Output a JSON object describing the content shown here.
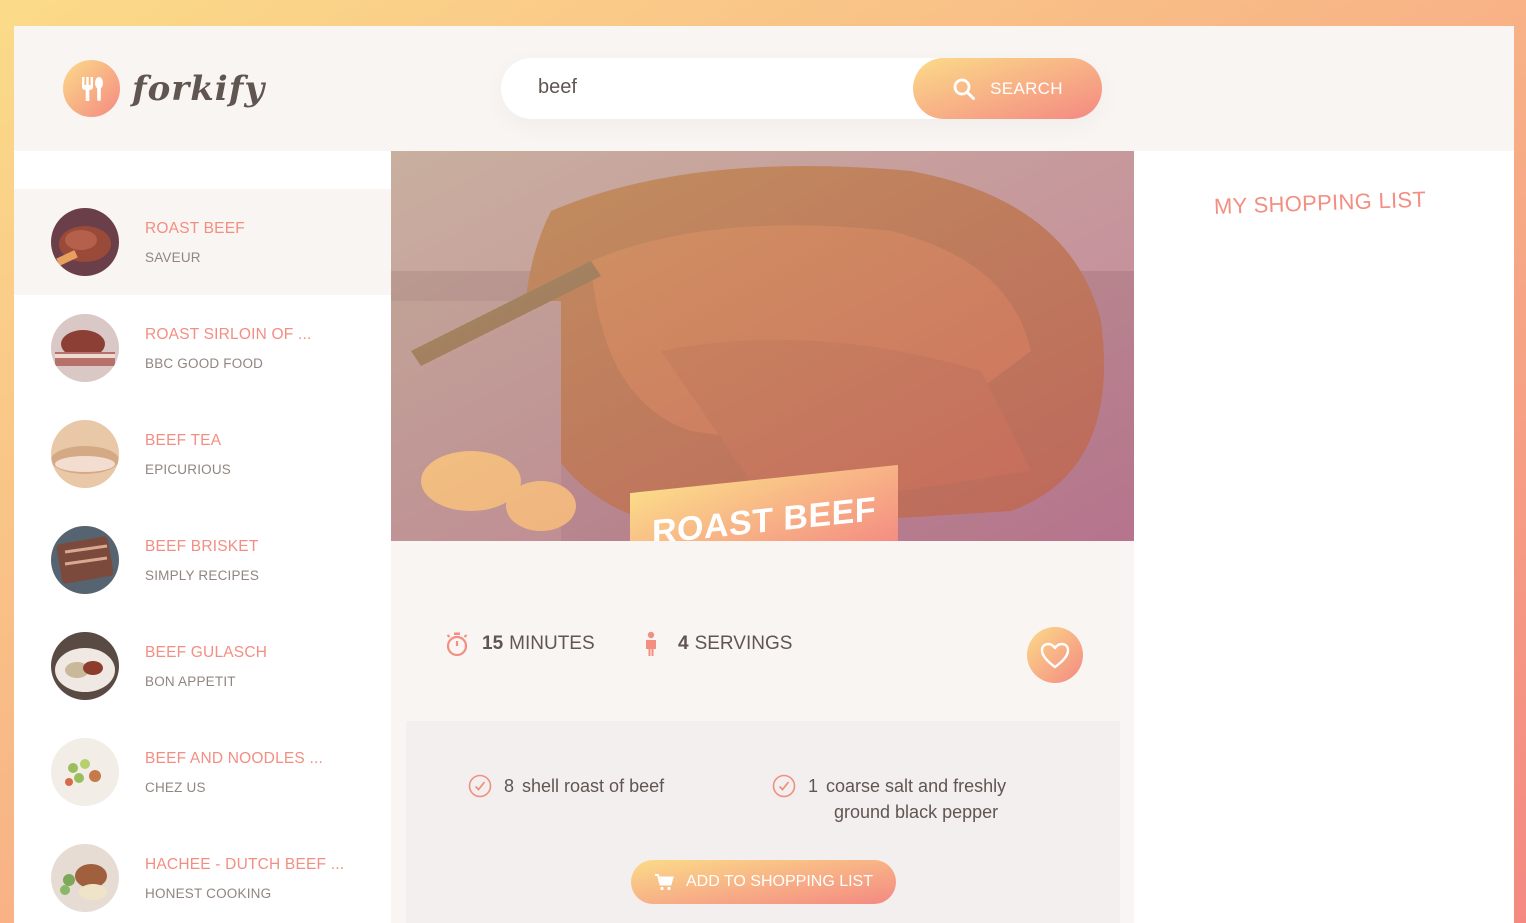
{
  "app": {
    "name": "forkify"
  },
  "search": {
    "value": "beef",
    "button_label": "SEARCH"
  },
  "results": [
    {
      "title": "ROAST BEEF",
      "publisher": "SAVEUR",
      "active": true
    },
    {
      "title": "ROAST SIRLOIN OF ...",
      "publisher": "BBC GOOD FOOD"
    },
    {
      "title": "BEEF TEA",
      "publisher": "EPICURIOUS"
    },
    {
      "title": "BEEF BRISKET",
      "publisher": "SIMPLY RECIPES"
    },
    {
      "title": "BEEF GULASCH",
      "publisher": "BON APPETIT"
    },
    {
      "title": "BEEF AND NOODLES ...",
      "publisher": "CHEZ US"
    },
    {
      "title": "HACHEE - DUTCH BEEF ...",
      "publisher": "HONEST COOKING"
    }
  ],
  "recipe": {
    "title": "ROAST BEEF",
    "time_value": "15",
    "time_label": "MINUTES",
    "servings_value": "4",
    "servings_label": "SERVINGS",
    "ingredients": [
      {
        "count": "8",
        "text": "shell roast of beef"
      },
      {
        "count": "1",
        "text_line1": "coarse salt and freshly",
        "text_line2": "ground black pepper"
      }
    ],
    "add_button_label": "ADD TO SHOPPING LIST"
  },
  "shopping": {
    "title": "MY SHOPPING LIST"
  },
  "colors": {
    "accent_start": "#fbdb89",
    "accent_end": "#f48982",
    "text": "#615551",
    "muted": "#918581"
  }
}
